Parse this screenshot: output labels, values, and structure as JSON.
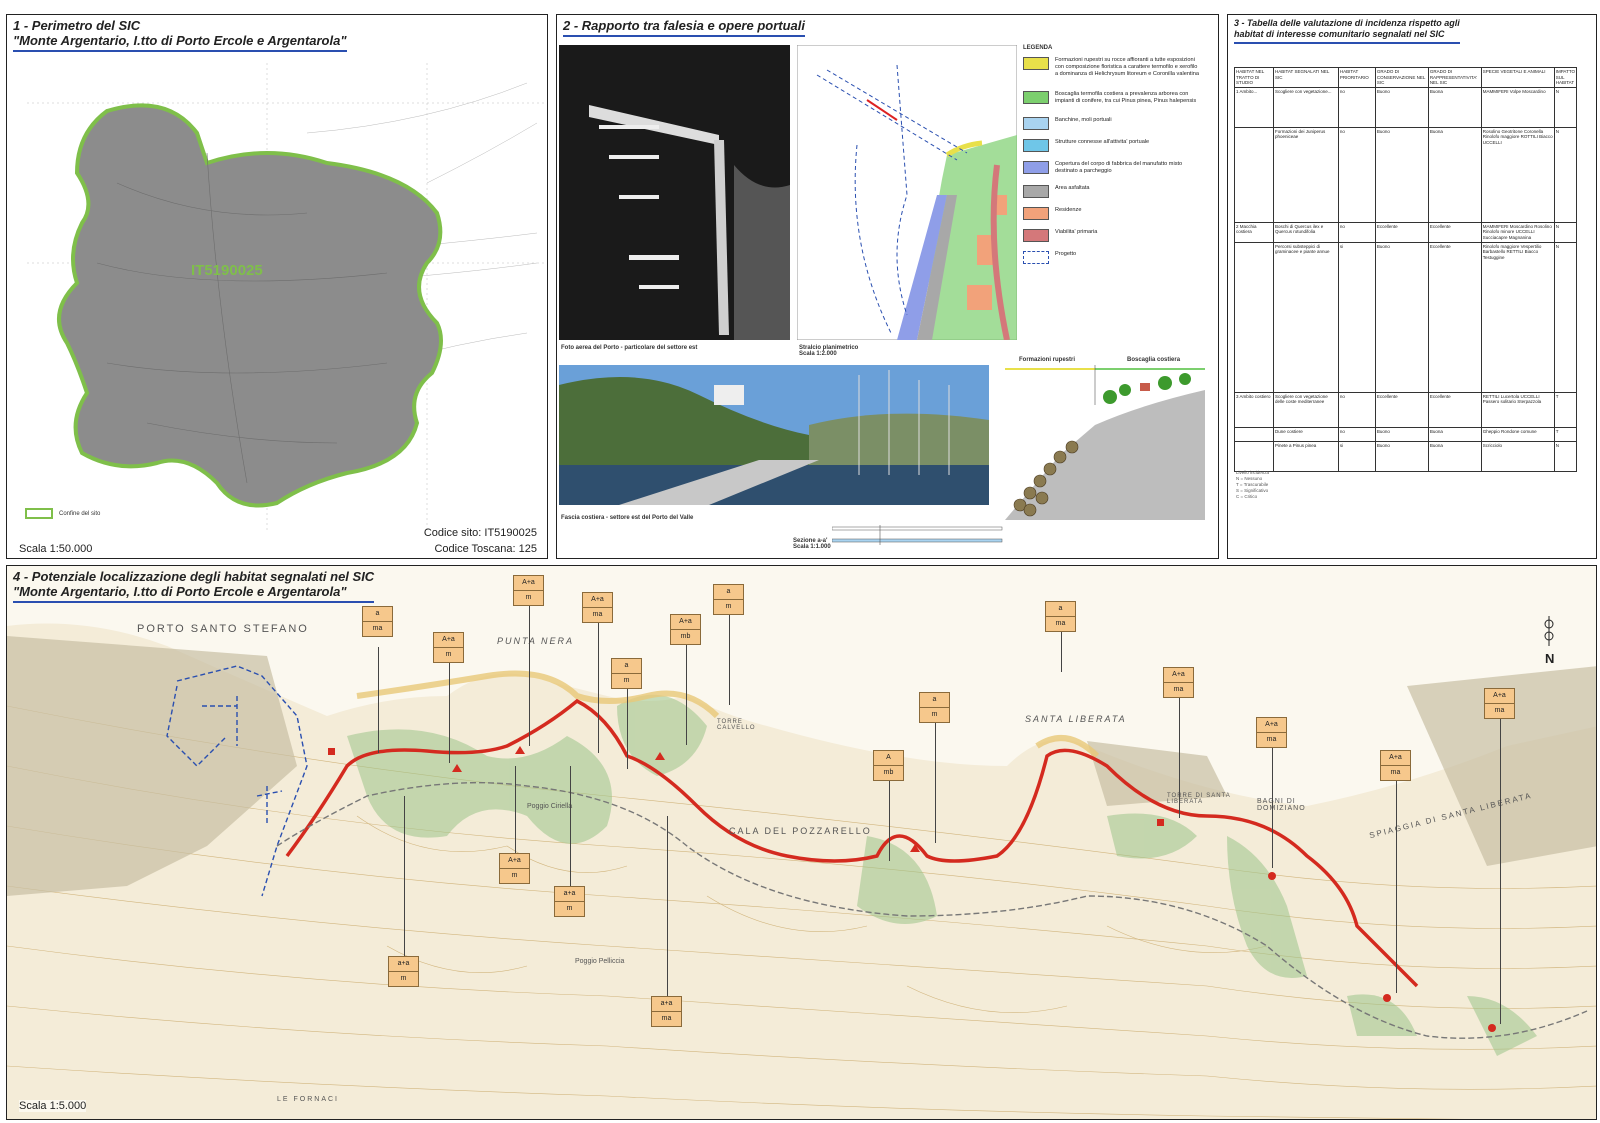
{
  "panel1": {
    "title": "1 - Perimetro del SIC",
    "subtitle": "\"Monte Argentario, I.tto di Porto Ercole e Argentarola\"",
    "site_label": "IT5190025",
    "legend_label": "Confine del sito",
    "scale": "Scala 1:50.000",
    "codice_sito": "Codice sito: IT5190025",
    "codice_toscana": "Codice Toscana: 125"
  },
  "panel2": {
    "title": "2 - Rapporto tra falesia e opere portuali",
    "photo1_caption": "Foto aerea del Porto - particolare del settore est",
    "plan_caption": "Stralcio planimetrico",
    "plan_scale": "Scala 1:2.000",
    "photo2_caption": "Fascia costiera - settore est del Porto del Valle",
    "section_caption": "Sezione a-a'",
    "section_scale": "Scala 1:1.000",
    "section_label_left": "Formazioni rupestri",
    "section_label_right": "Boscaglia costiera",
    "legend_title": "LEGENDA",
    "legend": [
      {
        "color": "#e8e04a",
        "text": "Formazioni rupestri su rocce affioranti a tutte esposizioni con composizione floristica a carattere termofilo e xerofilo a dominanza di Helichrysum litoreum e Coronilla valentina"
      },
      {
        "color": "#7ccf6e",
        "text": "Boscaglia termofila costiera a prevalenza arborea con impianti di conifere, tra cui Pinus pinea, Pinus halepensis"
      },
      {
        "color": "#a9d3f0",
        "text": "Banchine, moli portuali"
      },
      {
        "color": "#6fc6e8",
        "text": "Strutture connesse all'attivita' portuale"
      },
      {
        "color": "#8f9ee8",
        "text": "Copertura del corpo di fabbrica del manufatto misto destinato a parcheggio"
      },
      {
        "color": "#a8a8a8",
        "text": "Area asfaltata"
      },
      {
        "color": "#f2a27a",
        "text": "Residenze"
      },
      {
        "color": "#d4787a",
        "text": "Viabilita' primaria"
      },
      {
        "color": "#ffffff",
        "text": "Progetto"
      }
    ]
  },
  "panel3": {
    "title_line1": "3 - Tabella delle valutazione di incidenza rispetto agli",
    "title_line2": "habitat di interesse comunitario segnalati nel SIC",
    "headers": [
      "HABITAT NEL TRATTO DI STUDIO",
      "HABITAT SEGNALATI NEL SIC",
      "HABITAT PRIORITARIO",
      "GRADO DI CONSERVAZIONE NEL SIC",
      "GRADO DI RAPPRESENTATIVITA' NEL SIC",
      "SPECIE VEGETALI E ANIMALI",
      "IMPATTO SUL HABITAT"
    ],
    "rows": [
      [
        "1 Ambito...",
        "Scogliere con vegetazione...",
        "no",
        "Buono",
        "Buona",
        "MAMMIFERI Volpe Moscardino",
        "N"
      ],
      [
        "",
        "Formazioni dei Juniperus phoeniceae",
        "no",
        "Buono",
        "Buona",
        "Rosolino Geotritone Coronella Rinolofo maggiore ROTTILI Biacco UCCELLI",
        "N"
      ],
      [
        "2 Macchia costiera",
        "Boschi di Quercus ilex e Quercus rotundifolia",
        "no",
        "Eccellente",
        "Eccellente",
        "MAMMIFERI Moscardino Rosolino Rinolofo minore UCCELLI Succiacapre Magnanina",
        "N"
      ],
      [
        "",
        "Percorsi substeppici di graminacee e piante annue",
        "si",
        "Buono",
        "Eccellente",
        "Rinolofo maggiore Vespertilio Barbastello RETTILI Biacco Testuggine",
        "N"
      ],
      [
        "3 Ambito costiero",
        "Scogliere con vegetazione delle coste mediterranee",
        "no",
        "Eccellente",
        "Eccellente",
        "RETTILI Lucertola UCCELLI Passero solitario Sterpazzola",
        "T"
      ],
      [
        "",
        "Dune costiere",
        "no",
        "Buono",
        "Buona",
        "Gheppio Rondone comune",
        "T"
      ],
      [
        "",
        "Pinete a Pinus pinea",
        "si",
        "Buono",
        "Buona",
        "Scricciolo",
        "N"
      ]
    ],
    "notes": [
      "Livello incidenza",
      "N = Nessuno",
      "T = Trascurabile",
      "S = Significativo",
      "C = Critico"
    ]
  },
  "panel4": {
    "title": "4 - Potenziale localizzazione degli habitat segnalati nel SIC",
    "subtitle": "\"Monte Argentario, I.tto di Porto Ercole e Argentarola\"",
    "scale": "Scala 1:5.000",
    "north": "N",
    "place_names": [
      "PORTO SANTO STEFANO",
      "PUNTA NERA",
      "CALA DEL POZZARELLO",
      "SANTA LIBERATA",
      "TORRE DI SANTA LIBERATA",
      "BAGNI DI DOMIZIANO",
      "SPIAGGIA DI SANTA LIBERATA",
      "TORRE CALVELLO",
      "Poggio Pelliccia",
      "Poggio Ciriella",
      "LE FORNACI"
    ],
    "tags": [
      {
        "top": "a",
        "bottom": "ma"
      },
      {
        "top": "A+a",
        "bottom": "m"
      },
      {
        "top": "A+a",
        "bottom": "m"
      },
      {
        "top": "A+a",
        "bottom": "ma"
      },
      {
        "top": "a",
        "bottom": "m"
      },
      {
        "top": "A+a",
        "bottom": "mb"
      },
      {
        "top": "a",
        "bottom": "m"
      },
      {
        "top": "A+a",
        "bottom": "m"
      },
      {
        "top": "a+a",
        "bottom": "m"
      },
      {
        "top": "a+a",
        "bottom": "m"
      },
      {
        "top": "a+a",
        "bottom": "ma"
      },
      {
        "top": "A",
        "bottom": "mb"
      },
      {
        "top": "a",
        "bottom": "m"
      },
      {
        "top": "a",
        "bottom": "ma"
      },
      {
        "top": "A+a",
        "bottom": "ma"
      },
      {
        "top": "A+a",
        "bottom": "ma"
      },
      {
        "top": "A+a",
        "bottom": "ma"
      },
      {
        "top": "A+a",
        "bottom": "ma"
      }
    ]
  }
}
